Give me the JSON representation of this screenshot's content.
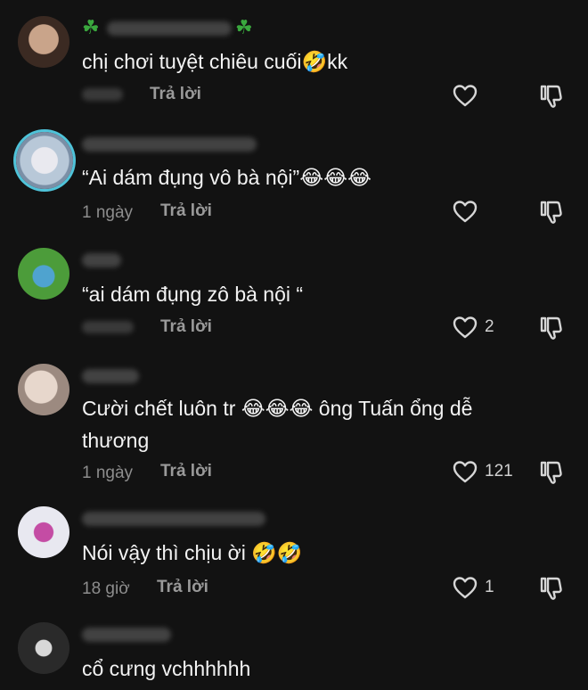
{
  "comments": [
    {
      "text": "chị chơi tuyệt chiêu cuối🤣kk",
      "time": "",
      "reply_label": "Trả lời",
      "likes": ""
    },
    {
      "text": "“Ai dám đụng vô bà nội”😂😂😂",
      "time": "1 ngày",
      "reply_label": "Trả lời",
      "likes": ""
    },
    {
      "text": "“ai dám đụng zô bà nội “",
      "time": "",
      "reply_label": "Trả lời",
      "likes": "2"
    },
    {
      "text": "Cười chết luôn tr 😂😂😂 ông Tuấn ổng dễ thương",
      "time": "1 ngày",
      "reply_label": "Trả lời",
      "likes": "121"
    },
    {
      "text": "Nói vậy thì chịu ời 🤣🤣",
      "time": "18 giờ",
      "reply_label": "Trả lời",
      "likes": "1"
    },
    {
      "text": "cổ cưng vchhhhhh",
      "time": "",
      "reply_label": "",
      "likes": ""
    }
  ],
  "colors": {
    "background": "#121212",
    "text": "#f3f3f3",
    "muted": "#8d8d8d",
    "ring": "#4fc3d9",
    "clover": "#3aa83e"
  },
  "icons": [
    "heart-icon",
    "dislike-icon",
    "clover-icon"
  ]
}
